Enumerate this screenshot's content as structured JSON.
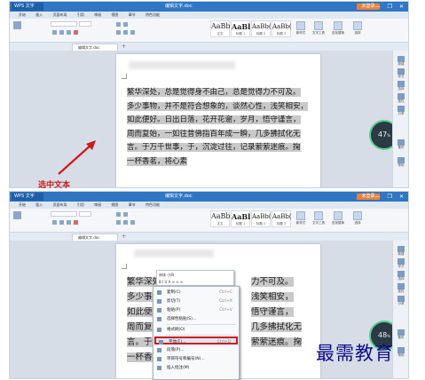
{
  "window": {
    "app_button": "WPS 文字",
    "title": "编辑文字.doc",
    "login": "未登录",
    "controls": "— ❐ ✕"
  },
  "menu": {
    "items": [
      "开始",
      "插入",
      "页面布局",
      "引用",
      "审阅",
      "视图",
      "章节",
      "特色功能"
    ]
  },
  "ribbon": {
    "styles": [
      {
        "sample": "AaBb",
        "label": "正文"
      },
      {
        "sample": "AaBl",
        "label": "标题 1"
      },
      {
        "sample": "AaBb(",
        "label": "标题 2"
      },
      {
        "sample": "AaBb(",
        "label": "标题 3"
      }
    ],
    "groups": [
      {
        "label": "新样式"
      },
      {
        "label": "文字工具"
      },
      {
        "label": "查找替换"
      },
      {
        "label": "选择"
      }
    ]
  },
  "doc_tab": {
    "label": "编辑文字.doc",
    "plus": "+"
  },
  "document": {
    "lines": [
      "繁华深处，总是觉得身不由己，总是觉得力不可及。",
      "多少事物，并不是符合想象的，谈然心性，浅笑相安，",
      "如此便好。日出日落，花开花谢，岁月，悟守谨言，",
      "周而复始，一如往昔佛指百年成一瞬，几多拂拭化无",
      "言。于万千世事，于，沉淀过往，记录萦萦迷痕。掬",
      "一杯香茗，将心素"
    ],
    "lines_short": [
      "繁华深处，总是觉",
      "多少事物，并不",
      "如此便好。",
      "周而复始，",
      "言。于万千",
      "一杯香茗，"
    ],
    "lines_tail": [
      "力不可及。",
      "浅笑相安，",
      "悟守谨言，",
      "几多拂拭化无",
      "萦萦迷痕。掬",
      ""
    ]
  },
  "right_panel": {
    "items": [
      "新建",
      "样式",
      "选择",
      "属性",
      "分享",
      "备份",
      "帮助"
    ]
  },
  "widget_top": {
    "value": "47",
    "unit": "%"
  },
  "widget_bottom": {
    "value": "48",
    "unit": "%"
  },
  "annotation": {
    "label": "选中文本",
    "color": "#d01a1a"
  },
  "mini_toolbar": {
    "font": "宋体",
    "size": "小四",
    "row2": "B I U A  ≡ ≡ ≡"
  },
  "context_menu": {
    "items": [
      {
        "label": "复制(C)",
        "shortcut": "Ctrl+C"
      },
      {
        "label": "剪切(T)",
        "shortcut": "Ctrl+X"
      },
      {
        "label": "粘贴(P)",
        "shortcut": "Ctrl+V"
      },
      {
        "label": "选择性粘贴(S)...",
        "shortcut": ""
      },
      {
        "label": "格式刷(O)",
        "shortcut": ""
      },
      {
        "label": "字体(F)...",
        "shortcut": "Ctrl+D"
      },
      {
        "label": "段落(P)...",
        "shortcut": ""
      },
      {
        "label": "项目符号和编号(N)...",
        "shortcut": ""
      },
      {
        "label": "插入批注(M)",
        "shortcut": ""
      }
    ],
    "selected_index": 5
  },
  "watermark": "最需教育",
  "colors": {
    "title_bar": "#2f77c5",
    "accent_red": "#d01a1a",
    "selection_gray": "#c9c9c9",
    "watermark_blue": "#0e0e8c"
  }
}
